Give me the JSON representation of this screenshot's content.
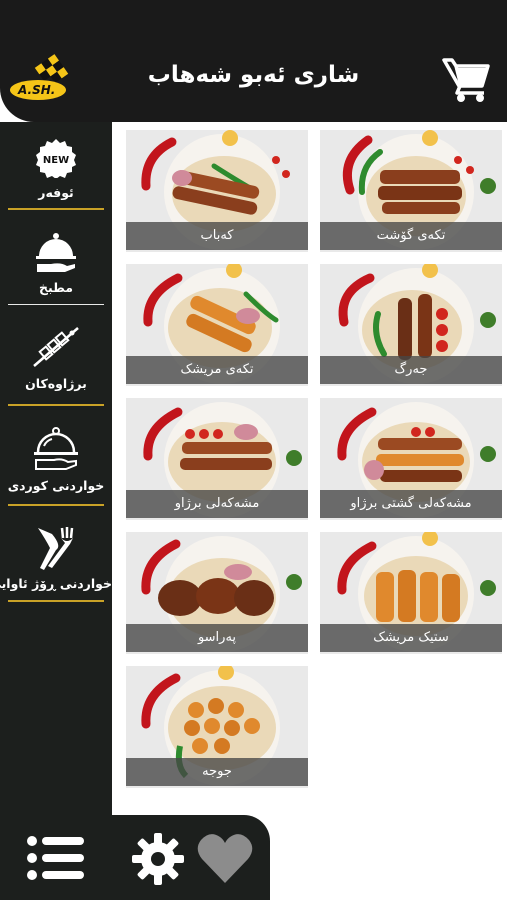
{
  "header": {
    "title": "شاری ئەبو شەهاب",
    "logo_text": "A.SH."
  },
  "sidebar": {
    "items": [
      {
        "label": "ئوفەر",
        "icon": "new-badge-icon",
        "badge": "NEW"
      },
      {
        "label": "مطبخ",
        "icon": "cloche-hand-icon"
      },
      {
        "label": "برژاوەکان",
        "icon": "skewer-icon"
      },
      {
        "label": "خواردنی کوردی",
        "icon": "food-tray-icon"
      },
      {
        "label": "خواردنی ڕۆژ ئاوایی",
        "icon": "fork-knife-icon"
      }
    ]
  },
  "menu": {
    "items": [
      {
        "label": "تکەی گۆشت"
      },
      {
        "label": "کەباب"
      },
      {
        "label": "جەرگ"
      },
      {
        "label": "تکەی مریشک"
      },
      {
        "label": "مشەکەلی گشتی برژاو"
      },
      {
        "label": "مشەکەلی برژاو"
      },
      {
        "label": "ستیک مریشک"
      },
      {
        "label": "پەراسو"
      },
      {
        "label": "جوجە"
      }
    ]
  },
  "footer": {
    "icons": [
      "menu-list-icon",
      "gear-icon",
      "heart-icon"
    ]
  },
  "colors": {
    "dark": "#1c1f1d",
    "accent_line": "#c9a227",
    "logo_yellow": "#f5c518"
  }
}
